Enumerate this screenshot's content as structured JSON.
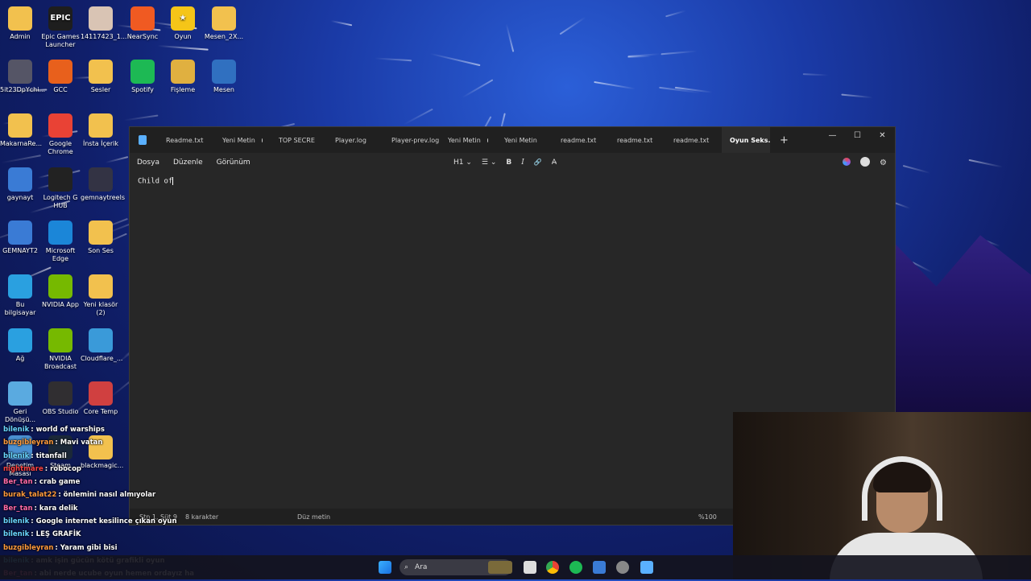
{
  "desktop_icons": [
    {
      "label": "Admin",
      "color": "#f2c14e"
    },
    {
      "label": "Epic Games Launcher",
      "color": "#1e1e1e",
      "glyph": "EPIC"
    },
    {
      "label": "14117423_1...",
      "color": "#d9c4b4"
    },
    {
      "label": "NearSync",
      "color": "#f05a22"
    },
    {
      "label": "Oyun",
      "color": "#f5c518",
      "glyph": "★"
    },
    {
      "label": "Mesen_2X...",
      "color": "#f2c14e"
    },
    {
      "label": "5it23DpYchi...",
      "color": "#556"
    },
    {
      "label": "GCC",
      "color": "#e8601c"
    },
    {
      "label": "Sesler",
      "color": "#f2c14e"
    },
    {
      "label": "Spotify",
      "color": "#1db954"
    },
    {
      "label": "Fişleme",
      "color": "#e0b040"
    },
    {
      "label": "Mesen",
      "color": "#3070c0"
    },
    {
      "label": "MakarnaRe...",
      "color": "#f2c14e"
    },
    {
      "label": "Google Chrome",
      "color": "#e94235"
    },
    {
      "label": "İnsta İçerik",
      "color": "#f2c14e"
    },
    {
      "label": "gaynayt",
      "color": "#3a7bd5"
    },
    {
      "label": "Logitech G HUB",
      "color": "#222"
    },
    {
      "label": "gemnaytreels",
      "color": "#334"
    },
    {
      "label": "GEMNAYT2",
      "color": "#3a7bd5"
    },
    {
      "label": "Microsoft Edge",
      "color": "#1b86d8"
    },
    {
      "label": "Son Ses",
      "color": "#f2c14e"
    },
    {
      "label": "Bu bilgisayar",
      "color": "#2aa0e0"
    },
    {
      "label": "NVIDIA App",
      "color": "#76b900"
    },
    {
      "label": "Yeni klasör (2)",
      "color": "#f2c14e"
    },
    {
      "label": "Ağ",
      "color": "#2aa0e0"
    },
    {
      "label": "NVIDIA Broadcast",
      "color": "#76b900"
    },
    {
      "label": "Cloudflare_...",
      "color": "#3a9ad9"
    },
    {
      "label": "Geri Dönüşü...",
      "color": "#5aaae0"
    },
    {
      "label": "OBS Studio",
      "color": "#302e31"
    },
    {
      "label": "Core Temp",
      "color": "#d04040"
    },
    {
      "label": "Denetim Masası",
      "color": "#4a90d0"
    },
    {
      "label": "Steam",
      "color": "#1b2838"
    },
    {
      "label": "blackmagic...",
      "color": "#f2c14e"
    }
  ],
  "notepad": {
    "tabs": [
      {
        "label": "Readme.txt",
        "dot": false,
        "active": false
      },
      {
        "label": "Yeni Metin",
        "dot": true,
        "active": false
      },
      {
        "label": "TOP SECRE",
        "dot": true,
        "active": false
      },
      {
        "label": "Player.log",
        "dot": false,
        "active": false
      },
      {
        "label": "Player-prev.log",
        "dot": false,
        "active": false
      },
      {
        "label": "Yeni Metin",
        "dot": true,
        "active": false
      },
      {
        "label": "Yeni Metin",
        "dot": false,
        "active": false
      },
      {
        "label": "readme.txt",
        "dot": false,
        "active": false
      },
      {
        "label": "readme.txt",
        "dot": false,
        "active": false
      },
      {
        "label": "readme.txt",
        "dot": false,
        "active": false
      },
      {
        "label": "Oyun Seks.",
        "dot": true,
        "active": true
      }
    ],
    "new_tab": "+",
    "menu": {
      "file": "Dosya",
      "edit": "Düzenle",
      "view": "Görünüm"
    },
    "toolbar": {
      "heading": "H1",
      "chev": "⌄",
      "list": "☰",
      "bold": "B",
      "italic": "I",
      "link": "🔗",
      "clear": "A̶"
    },
    "controls": {
      "min": "—",
      "max": "☐",
      "close": "✕"
    },
    "content": "Child of",
    "status": {
      "position": "Stn 1, Süt 9",
      "chars": "8 karakter",
      "format": "Düz metin",
      "zoom": "%100"
    }
  },
  "taskbar": {
    "search_label": "Ara"
  },
  "chat": [
    {
      "user": "bilenik",
      "color": "#6ad6ff",
      "text": ": world of warships"
    },
    {
      "user": "buzgibleyran",
      "color": "#ff9a3c",
      "text": ": Mavi vatan"
    },
    {
      "user": "bilenik",
      "color": "#6ad6ff",
      "text": ": titanfall"
    },
    {
      "user": "nightmare",
      "color": "#ff4444",
      "text": ": robocop"
    },
    {
      "user": "Ber_tan",
      "color": "#ff6aa8",
      "text": ": crab game"
    },
    {
      "user": "burak_talat22",
      "color": "#ff9a3c",
      "text": ": önlemini nasıl almıyolar"
    },
    {
      "user": "Ber_tan",
      "color": "#ff6aa8",
      "text": ": kara delik"
    },
    {
      "user": "bilenik",
      "color": "#6ad6ff",
      "text": ": Google internet kesilince çıkan oyun"
    },
    {
      "user": "bilenik",
      "color": "#6ad6ff",
      "text": ": LEŞ GRAFİK"
    },
    {
      "user": "buzgibleyran",
      "color": "#ff9a3c",
      "text": ": Yaram gibi bisi"
    },
    {
      "user": "bilenik",
      "color": "#6ad6ff",
      "text": ": amk işin gücün kötü grafikli oyun"
    },
    {
      "user": "Ber_tan",
      "color": "#ff6aa8",
      "text": ": abi nerde ucube oyun hemen ordayız ha"
    }
  ]
}
